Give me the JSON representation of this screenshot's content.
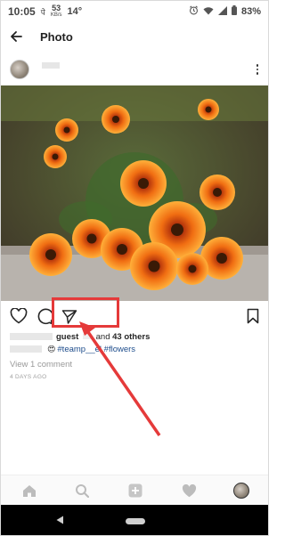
{
  "status_bar": {
    "time": "10:05",
    "speed_value": "53",
    "speed_unit": "KB/s",
    "temperature": "14°",
    "battery": "83%"
  },
  "app_bar": {
    "title": "Photo",
    "back_icon": "arrow-left-icon"
  },
  "post": {
    "likes_text_prefix": "and ",
    "likes_count": "43 others",
    "likes_user_fragment": "guest",
    "caption_hashtags": "#teamp__el #flowers",
    "comments_link": "View 1 comment",
    "posted_time": "4 DAYS AGO"
  },
  "actions": {
    "like_icon": "heart-icon",
    "comment_icon": "comment-icon",
    "share_icon": "paper-plane-icon",
    "save_icon": "bookmark-icon"
  },
  "tab_bar": {
    "items": [
      "home-icon",
      "search-icon",
      "add-icon",
      "heart-icon",
      "profile-avatar"
    ]
  },
  "colors": {
    "highlight": "#e53a3a",
    "hashtag": "#1e4d8c"
  }
}
